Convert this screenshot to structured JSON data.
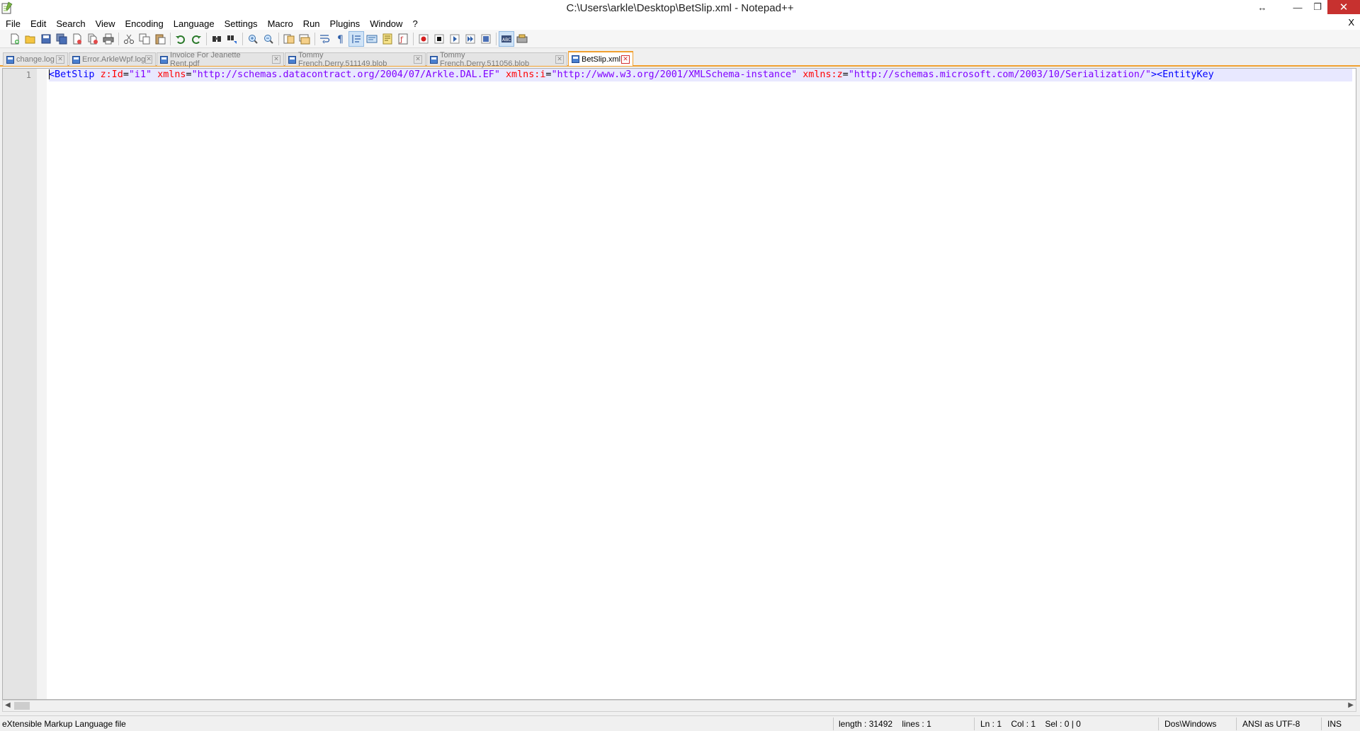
{
  "window": {
    "title": "C:\\Users\\arkle\\Desktop\\BetSlip.xml - Notepad++",
    "restore_arrows_glyph": "↔",
    "minimize_glyph": "—",
    "maximize_glyph": "❐",
    "close_glyph": "✕",
    "doc_close_glyph": "X"
  },
  "menu": [
    "File",
    "Edit",
    "Search",
    "View",
    "Encoding",
    "Language",
    "Settings",
    "Macro",
    "Run",
    "Plugins",
    "Window",
    "?"
  ],
  "toolbar_icons": [
    "new-file-icon",
    "open-file-icon",
    "save-icon",
    "save-all-icon",
    "close-icon",
    "close-all-icon",
    "print-icon",
    "cut-icon",
    "copy-icon",
    "paste-icon",
    "undo-icon",
    "redo-icon",
    "find-icon",
    "replace-icon",
    "zoom-in-icon",
    "zoom-out-icon",
    "sync-vertical-icon",
    "sync-horizontal-icon",
    "word-wrap-icon",
    "show-all-characters-icon",
    "indent-guide-icon",
    "user-language-icon",
    "document-map-icon",
    "function-list-icon",
    "record-macro-icon",
    "stop-record-icon",
    "play-macro-icon",
    "run-macro-multiple-icon",
    "save-macro-icon",
    "spell-check-icon",
    "plugin-icon"
  ],
  "tabs": [
    {
      "label": "change.log",
      "active": false
    },
    {
      "label": "Error.ArkleWpf.log",
      "active": false
    },
    {
      "label": "Invoice For Jeanette Rent.pdf",
      "active": false
    },
    {
      "label": "Tommy French.Derry.511149.blob",
      "active": false
    },
    {
      "label": "Tommy French.Derry.511056.blob",
      "active": false
    },
    {
      "label": "BetSlip.xml",
      "active": true
    }
  ],
  "editor": {
    "line_number": "1",
    "code": {
      "tag_open": "<BetSlip",
      "attr1": "z:Id",
      "val1": "\"i1\"",
      "attr2": "xmlns",
      "val2": "\"http://schemas.datacontract.org/2004/07/Arkle.DAL.EF\"",
      "attr3": "xmlns:i",
      "val3": "\"http://www.w3.org/2001/XMLSchema-instance\"",
      "attr4": "xmlns:z",
      "val4": "\"http://schemas.microsoft.com/2003/10/Serialization/\"",
      "tag_close": "><EntityKey",
      "equals": "="
    }
  },
  "statusbar": {
    "file_type": "eXtensible Markup Language file",
    "length": "length : 31492    lines : 1",
    "position": "Ln : 1    Col : 1    Sel : 0 | 0",
    "eol": "Dos\\Windows",
    "encoding": "ANSI as UTF-8",
    "mode": "INS"
  },
  "colors": {
    "tag": "#0000ff",
    "attribute": "#ff0000",
    "value": "#8000ff",
    "active_tab_accent": "#f0a030",
    "current_line": "#e8e8ff",
    "close_button": "#c7312f"
  }
}
